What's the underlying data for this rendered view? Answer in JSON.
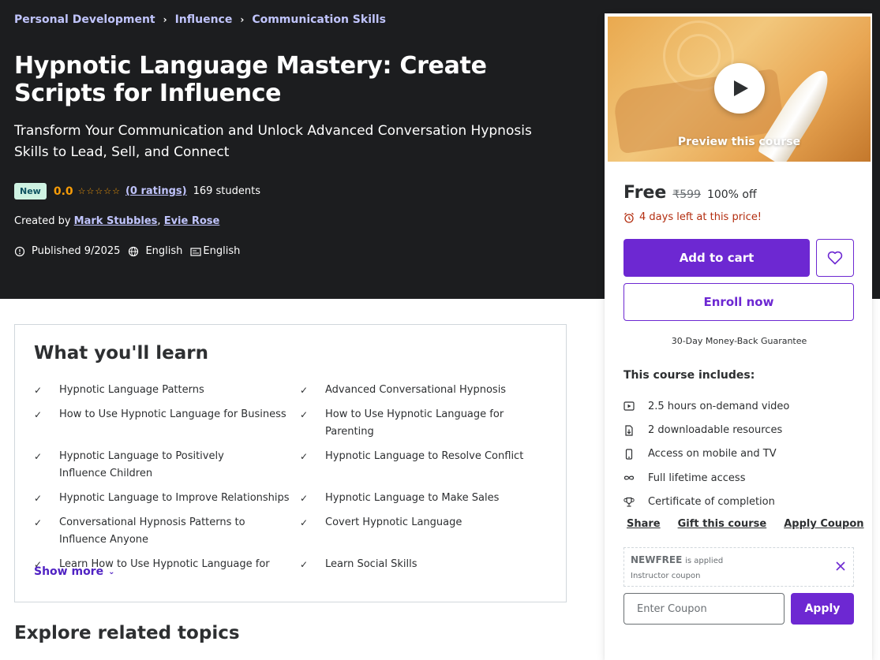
{
  "breadcrumb": [
    "Personal Development",
    "Influence",
    "Communication Skills"
  ],
  "course": {
    "title": "Hypnotic Language Mastery: Create Scripts for Influence",
    "subtitle": "Transform Your Communication and Unlock Advanced Conversation Hypnosis Skills to Lead, Sell, and Connect",
    "badge": "New",
    "rating": "0.0",
    "ratings_link": "(0 ratings)",
    "students": "169 students",
    "created_by_label": "Created by",
    "authors": [
      "Mark Stubbles",
      "Evie Rose"
    ],
    "published": "Published 9/2025",
    "language": "English",
    "captions": "English"
  },
  "learn": {
    "title": "What you'll learn",
    "items": [
      "Hypnotic Language Patterns",
      "Advanced Conversational Hypnosis",
      "How to Use Hypnotic Language for Business",
      "How to Use Hypnotic Language for Parenting",
      "Hypnotic Language to Positively Influence Children",
      "Hypnotic Language to Resolve Conflict",
      "Hypnotic Language to Improve Relationships",
      "Hypnotic Language to Make Sales",
      "Conversational Hypnosis Patterns to Influence Anyone",
      "Covert Hypnotic Language",
      "Learn How to Use Hypnotic Language for",
      "Learn Social Skills"
    ],
    "show_more": "Show more"
  },
  "explore_title": "Explore related topics",
  "sidebar": {
    "preview_caption": "Preview this course",
    "price": "Free",
    "original_price": "₹599",
    "discount": "100% off",
    "deadline": "4 days left at this price!",
    "add_to_cart": "Add to cart",
    "enroll": "Enroll now",
    "guarantee": "30-Day Money-Back Guarantee",
    "includes_title": "This course includes:",
    "includes": [
      {
        "icon": "video-icon",
        "label": "2.5 hours on-demand video"
      },
      {
        "icon": "file-download-icon",
        "label": "2 downloadable resources"
      },
      {
        "icon": "mobile-icon",
        "label": "Access on mobile and TV"
      },
      {
        "icon": "infinity-icon",
        "label": "Full lifetime access"
      },
      {
        "icon": "trophy-icon",
        "label": "Certificate of completion"
      }
    ],
    "links": [
      "Share",
      "Gift this course",
      "Apply Coupon"
    ],
    "coupon_code": "NEWFREE",
    "coupon_applied": "is applied",
    "coupon_type": "Instructor coupon",
    "coupon_placeholder": "Enter Coupon",
    "apply": "Apply"
  },
  "colors": {
    "hero_bg": "#1c1d1f",
    "link_purple": "#c0c4fc",
    "accent": "#6d28d2",
    "star": "#f69c08",
    "deadline": "#b32d0f",
    "badge_bg": "#cef2e2"
  }
}
